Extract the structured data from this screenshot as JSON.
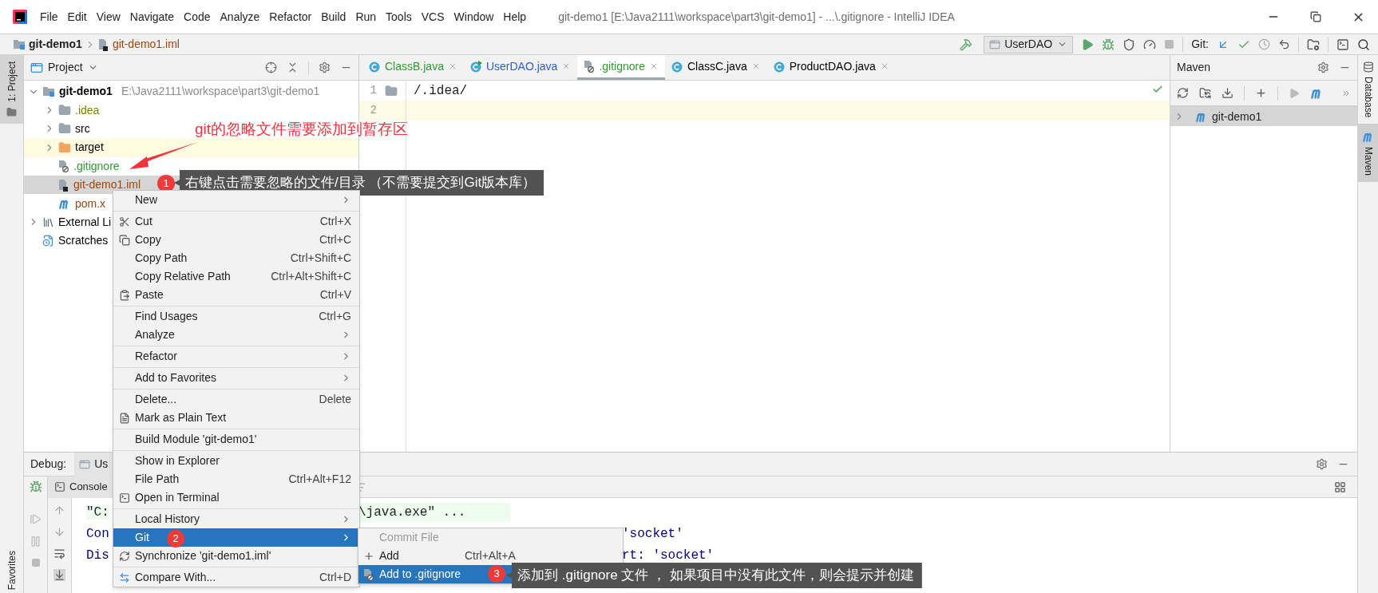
{
  "title_bar": {
    "menu": [
      "File",
      "Edit",
      "View",
      "Navigate",
      "Code",
      "Analyze",
      "Refactor",
      "Build",
      "Run",
      "Tools",
      "VCS",
      "Window",
      "Help"
    ],
    "title": "git-demo1 [E:\\Java2111\\workspace\\part3\\git-demo1] - ...\\.gitignore - IntelliJ IDEA"
  },
  "nav_bar": {
    "breadcrumb": [
      "git-demo1",
      "git-demo1.iml"
    ],
    "run_config": "UserDAO",
    "git_label": "Git:"
  },
  "left_stripe": {
    "tabs": [
      {
        "label": "1: Project",
        "selected": true
      }
    ],
    "bottom": "Favorites"
  },
  "right_stripe": [
    {
      "label": "Database",
      "kind": "database",
      "selected": false
    },
    {
      "label": "Maven",
      "kind": "maven",
      "selected": true
    }
  ],
  "project": {
    "title": "Project",
    "tree": [
      {
        "name": "git-demo1",
        "path": "E:\\Java2111\\workspace\\part3\\git-demo1",
        "kind": "module",
        "expanded": true,
        "selected": false,
        "highlighted": false,
        "color": "#000000",
        "children": [
          {
            "name": ".idea",
            "kind": "folder",
            "expanded": false,
            "selected": false,
            "highlighted": false,
            "color": "#808000"
          },
          {
            "name": "src",
            "kind": "folder",
            "expanded": false,
            "selected": false,
            "highlighted": false,
            "color": "#000000"
          },
          {
            "name": "target",
            "kind": "excluded-folder",
            "expanded": false,
            "selected": false,
            "highlighted": true,
            "color": "#000000"
          },
          {
            "name": ".gitignore",
            "kind": "ignore-file",
            "selected": false,
            "highlighted": false,
            "color": "#2e9b2e"
          },
          {
            "name": "git-demo1.iml",
            "kind": "module-file",
            "selected": true,
            "highlighted": false,
            "color": "#a1450d"
          },
          {
            "name": "pom.x",
            "kind": "maven-file",
            "selected": false,
            "highlighted": false,
            "color": "#a1450d"
          }
        ]
      },
      {
        "name": "External Li",
        "kind": "libraries",
        "expanded": false,
        "selected": false,
        "highlighted": false,
        "color": "#000000"
      },
      {
        "name": "Scratches",
        "kind": "scratches",
        "selected": false,
        "highlighted": false,
        "color": "#000000"
      }
    ]
  },
  "editor": {
    "tabs": [
      {
        "label": "ClassB.java",
        "kind": "class",
        "selected": false,
        "color": "#2e9b2e"
      },
      {
        "label": "UserDAO.java",
        "kind": "runnable-class",
        "selected": false,
        "color": "#2f5fc7"
      },
      {
        "label": ".gitignore",
        "kind": "ignore-file",
        "selected": true,
        "color": "#2e9b2e"
      },
      {
        "label": "ClassC.java",
        "kind": "class",
        "selected": false,
        "color": "#000000"
      },
      {
        "label": "ProductDAO.java",
        "kind": "class",
        "selected": false,
        "color": "#000000"
      }
    ],
    "lines": [
      {
        "number": "1",
        "text": "/.idea/",
        "current": false
      },
      {
        "number": "2",
        "current": true
      }
    ]
  },
  "maven": {
    "title": "Maven",
    "tree": [
      {
        "name": "git-demo1",
        "expanded": false,
        "selected": true
      }
    ]
  },
  "debug": {
    "label": "Debug:",
    "session_tab": "Us",
    "console_tab": "Console",
    "console_lines": [
      {
        "kind": "command",
        "left": "\"C:",
        "middle": "\\java.exe\" ..."
      },
      {
        "kind": "output",
        "left": "Con",
        "right": "'socket'"
      },
      {
        "kind": "output",
        "left": "Dis",
        "right": "rt: 'socket'"
      }
    ]
  },
  "context_menu": {
    "items": [
      {
        "kind": "item",
        "label": "New",
        "submenu": true,
        "selected": false
      },
      {
        "kind": "separator"
      },
      {
        "kind": "scissors",
        "label": "Cut",
        "shortcut": "Ctrl+X",
        "submenu": false,
        "selected": false
      },
      {
        "kind": "copy",
        "label": "Copy",
        "shortcut": "Ctrl+C",
        "submenu": false,
        "selected": false
      },
      {
        "kind": "item",
        "label": "Copy Path",
        "shortcut": "Ctrl+Shift+C",
        "submenu": false,
        "selected": false
      },
      {
        "kind": "item",
        "label": "Copy Relative Path",
        "shortcut": "Ctrl+Alt+Shift+C",
        "submenu": false,
        "selected": false
      },
      {
        "kind": "clipboard",
        "label": "Paste",
        "shortcut": "Ctrl+V",
        "submenu": false,
        "selected": false
      },
      {
        "kind": "separator"
      },
      {
        "kind": "item",
        "label": "Find Usages",
        "shortcut": "Ctrl+G",
        "submenu": false,
        "selected": false
      },
      {
        "kind": "item",
        "label": "Analyze",
        "submenu": true,
        "selected": false
      },
      {
        "kind": "separator"
      },
      {
        "kind": "item",
        "label": "Refactor",
        "submenu": true,
        "selected": false
      },
      {
        "kind": "separator"
      },
      {
        "kind": "item",
        "label": "Add to Favorites",
        "submenu": true,
        "selected": false
      },
      {
        "kind": "separator"
      },
      {
        "kind": "item",
        "label": "Delete...",
        "shortcut": "Delete",
        "submenu": false,
        "selected": false
      },
      {
        "kind": "document",
        "label": "Mark as Plain Text",
        "submenu": false,
        "selected": false
      },
      {
        "kind": "separator"
      },
      {
        "kind": "item",
        "label": "Build Module 'git-demo1'",
        "submenu": false,
        "selected": false
      },
      {
        "kind": "separator"
      },
      {
        "kind": "item",
        "label": "Show in Explorer",
        "submenu": false,
        "selected": false
      },
      {
        "kind": "item",
        "label": "File Path",
        "shortcut": "Ctrl+Alt+F12",
        "submenu": false,
        "selected": false
      },
      {
        "kind": "terminal",
        "label": "Open in Terminal",
        "submenu": false,
        "selected": false
      },
      {
        "kind": "separator"
      },
      {
        "kind": "item",
        "label": "Local History",
        "submenu": true,
        "selected": false
      },
      {
        "kind": "item",
        "label": "Git",
        "submenu": true,
        "selected": true
      },
      {
        "kind": "sync",
        "label": "Synchronize 'git-demo1.iml'",
        "submenu": false,
        "selected": false
      },
      {
        "kind": "separator"
      },
      {
        "kind": "compare",
        "label": "Compare With...",
        "shortcut": "Ctrl+D",
        "submenu": false,
        "selected": false
      }
    ]
  },
  "git_submenu": {
    "items": [
      {
        "kind": "item",
        "label": "Commit File",
        "disabled": true,
        "selected": false
      },
      {
        "kind": "add",
        "label": "Add",
        "shortcut": "Ctrl+Alt+A",
        "disabled": false,
        "selected": false
      },
      {
        "kind": "ignore",
        "label": "Add to .gitignore",
        "disabled": false,
        "selected": true
      }
    ]
  },
  "annotation": "git的忽略文件需要添加到暂存区",
  "callouts": [
    {
      "badge": "1",
      "text": "右键点击需要忽略的文件/目录 （不需要提交到Git版本库）"
    },
    {
      "badge": "2"
    },
    {
      "badge": "3",
      "text": "添加到 .gitignore 文件 ， 如果项目中没有此文件，则会提示并创建"
    }
  ]
}
